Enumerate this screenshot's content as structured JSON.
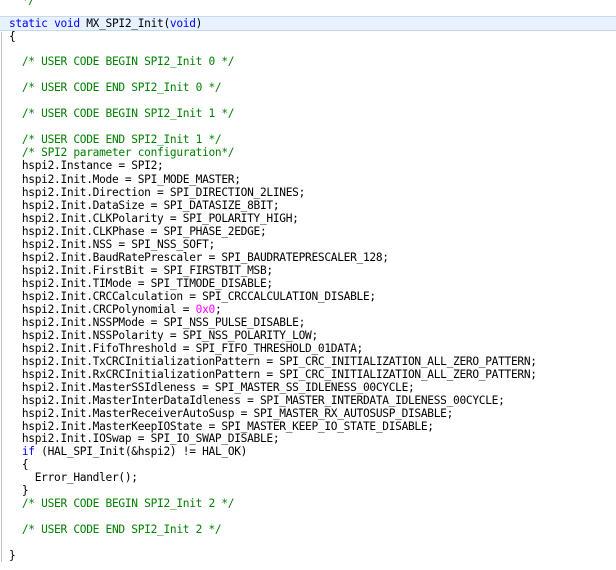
{
  "editor": {
    "lines": [
      {
        "id": "l0",
        "segments": [
          {
            "t": "c",
            "v": "  */"
          }
        ]
      },
      {
        "id": "l1",
        "hl": true,
        "segments": [
          {
            "t": "k",
            "v": "static"
          },
          {
            "t": "p",
            "v": " "
          },
          {
            "t": "k",
            "v": "void"
          },
          {
            "t": "p",
            "v": " MX_SPI2_Init("
          },
          {
            "t": "k",
            "v": "void"
          },
          {
            "t": "p",
            "v": ")"
          }
        ]
      },
      {
        "id": "l2",
        "segments": [
          {
            "t": "p",
            "v": "{"
          }
        ]
      },
      {
        "id": "l3",
        "segments": [
          {
            "t": "p",
            "v": ""
          }
        ]
      },
      {
        "id": "l4",
        "segments": [
          {
            "t": "c",
            "v": "  /* USER CODE BEGIN SPI2_Init 0 */"
          }
        ]
      },
      {
        "id": "l5",
        "segments": [
          {
            "t": "p",
            "v": ""
          }
        ]
      },
      {
        "id": "l6",
        "segments": [
          {
            "t": "c",
            "v": "  /* USER CODE END SPI2_Init 0 */"
          }
        ]
      },
      {
        "id": "l7",
        "segments": [
          {
            "t": "p",
            "v": ""
          }
        ]
      },
      {
        "id": "l8",
        "segments": [
          {
            "t": "c",
            "v": "  /* USER CODE BEGIN SPI2_Init 1 */"
          }
        ]
      },
      {
        "id": "l9",
        "segments": [
          {
            "t": "p",
            "v": ""
          }
        ]
      },
      {
        "id": "l10",
        "segments": [
          {
            "t": "c",
            "v": "  /* USER CODE END SPI2_Init 1 */"
          }
        ]
      },
      {
        "id": "l11",
        "segments": [
          {
            "t": "c",
            "v": "  /* SPI2 parameter configuration*/"
          }
        ]
      },
      {
        "id": "l12",
        "segments": [
          {
            "t": "p",
            "v": "  hspi2.Instance = SPI2;"
          }
        ]
      },
      {
        "id": "l13",
        "segments": [
          {
            "t": "p",
            "v": "  hspi2.Init.Mode = SPI_MODE_MASTER;"
          }
        ]
      },
      {
        "id": "l14",
        "segments": [
          {
            "t": "p",
            "v": "  hspi2.Init.Direction = SPI_DIRECTION_2LINES;"
          }
        ]
      },
      {
        "id": "l15",
        "segments": [
          {
            "t": "p",
            "v": "  hspi2.Init.DataSize = SPI_DATASIZE_8BIT;"
          }
        ]
      },
      {
        "id": "l16",
        "segments": [
          {
            "t": "p",
            "v": "  hspi2.Init.CLKPolarity = SPI_POLARITY_HIGH;"
          }
        ]
      },
      {
        "id": "l17",
        "segments": [
          {
            "t": "p",
            "v": "  hspi2.Init.CLKPhase = SPI_PHASE_2EDGE;"
          }
        ]
      },
      {
        "id": "l18",
        "segments": [
          {
            "t": "p",
            "v": "  hspi2.Init.NSS = SPI_NSS_SOFT;"
          }
        ]
      },
      {
        "id": "l19",
        "segments": [
          {
            "t": "p",
            "v": "  hspi2.Init.BaudRatePrescaler = SPI_BAUDRATEPRESCALER_128;"
          }
        ]
      },
      {
        "id": "l20",
        "segments": [
          {
            "t": "p",
            "v": "  hspi2.Init.FirstBit = SPI_FIRSTBIT_MSB;"
          }
        ]
      },
      {
        "id": "l21",
        "segments": [
          {
            "t": "p",
            "v": "  hspi2.Init.TIMode = SPI_TIMODE_DISABLE;"
          }
        ]
      },
      {
        "id": "l22",
        "segments": [
          {
            "t": "p",
            "v": "  hspi2.Init.CRCCalculation = SPI_CRCCALCULATION_DISABLE;"
          }
        ]
      },
      {
        "id": "l23",
        "segments": [
          {
            "t": "p",
            "v": "  hspi2.Init.CRCPolynomial = "
          },
          {
            "t": "n",
            "v": "0x0"
          },
          {
            "t": "p",
            "v": ";"
          }
        ]
      },
      {
        "id": "l24",
        "segments": [
          {
            "t": "p",
            "v": "  hspi2.Init.NSSPMode = SPI_NSS_PULSE_DISABLE;"
          }
        ]
      },
      {
        "id": "l25",
        "segments": [
          {
            "t": "p",
            "v": "  hspi2.Init.NSSPolarity = SPI_NSS_POLARITY_LOW;"
          }
        ]
      },
      {
        "id": "l26",
        "segments": [
          {
            "t": "p",
            "v": "  hspi2.Init.FifoThreshold = SPI_FIFO_THRESHOLD_01DATA;"
          }
        ]
      },
      {
        "id": "l27",
        "segments": [
          {
            "t": "p",
            "v": "  hspi2.Init.TxCRCInitializationPattern = SPI_CRC_INITIALIZATION_ALL_ZERO_PATTERN;"
          }
        ]
      },
      {
        "id": "l28",
        "segments": [
          {
            "t": "p",
            "v": "  hspi2.Init.RxCRCInitializationPattern = SPI_CRC_INITIALIZATION_ALL_ZERO_PATTERN;"
          }
        ]
      },
      {
        "id": "l29",
        "segments": [
          {
            "t": "p",
            "v": "  hspi2.Init.MasterSSIdleness = SPI_MASTER_SS_IDLENESS_00CYCLE;"
          }
        ]
      },
      {
        "id": "l30",
        "segments": [
          {
            "t": "p",
            "v": "  hspi2.Init.MasterInterDataIdleness = SPI_MASTER_INTERDATA_IDLENESS_00CYCLE;"
          }
        ]
      },
      {
        "id": "l31",
        "segments": [
          {
            "t": "p",
            "v": "  hspi2.Init.MasterReceiverAutoSusp = SPI_MASTER_RX_AUTOSUSP_DISABLE;"
          }
        ]
      },
      {
        "id": "l32",
        "segments": [
          {
            "t": "p",
            "v": "  hspi2.Init.MasterKeepIOState = SPI_MASTER_KEEP_IO_STATE_DISABLE;"
          }
        ]
      },
      {
        "id": "l33",
        "segments": [
          {
            "t": "p",
            "v": "  hspi2.Init.IOSwap = SPI_IO_SWAP_DISABLE;"
          }
        ]
      },
      {
        "id": "l34",
        "segments": [
          {
            "t": "p",
            "v": "  "
          },
          {
            "t": "k",
            "v": "if"
          },
          {
            "t": "p",
            "v": " (HAL_SPI_Init(&hspi2) != HAL_OK)"
          }
        ]
      },
      {
        "id": "l35",
        "segments": [
          {
            "t": "p",
            "v": "  {"
          }
        ]
      },
      {
        "id": "l36",
        "segments": [
          {
            "t": "p",
            "v": "    Error_Handler();"
          }
        ]
      },
      {
        "id": "l37",
        "segments": [
          {
            "t": "p",
            "v": "  }"
          }
        ]
      },
      {
        "id": "l38",
        "segments": [
          {
            "t": "c",
            "v": "  /* USER CODE BEGIN SPI2_Init 2 */"
          }
        ]
      },
      {
        "id": "l39",
        "segments": [
          {
            "t": "p",
            "v": ""
          }
        ]
      },
      {
        "id": "l40",
        "segments": [
          {
            "t": "c",
            "v": "  /* USER CODE END SPI2_Init 2 */"
          }
        ]
      },
      {
        "id": "l41",
        "segments": [
          {
            "t": "p",
            "v": ""
          }
        ]
      },
      {
        "id": "l42",
        "segments": [
          {
            "t": "p",
            "v": "}"
          }
        ]
      }
    ],
    "colors": {
      "keyword": "#0000ff",
      "comment": "#008000",
      "number": "#ff00ff",
      "text": "#000000",
      "highlight_bg": "#e8f2fe"
    }
  }
}
